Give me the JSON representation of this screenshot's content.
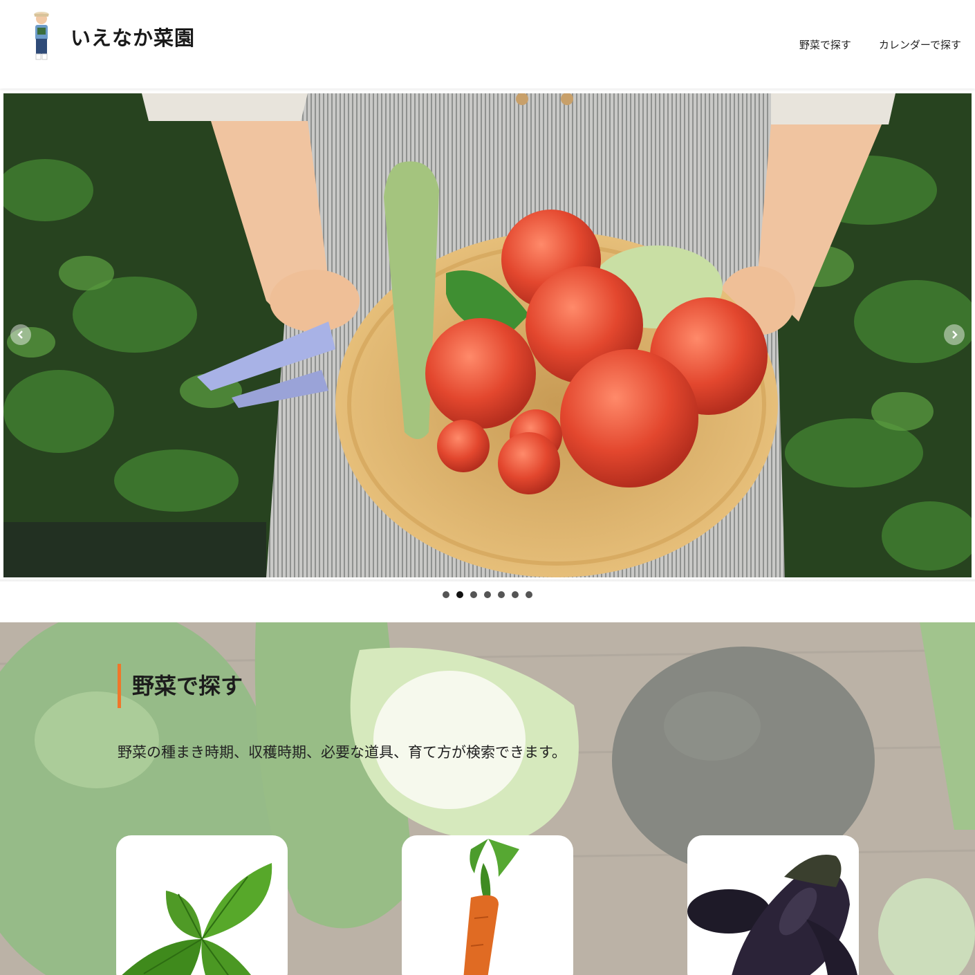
{
  "site": {
    "title": "いえなか菜園"
  },
  "nav": {
    "items": [
      {
        "label": "野菜で探す"
      },
      {
        "label": "カレンダーで探す"
      }
    ]
  },
  "slider": {
    "slide_count": 7,
    "active_index": 1
  },
  "vegetable_search": {
    "heading": "野菜で探す",
    "description": "野菜の種まき時期、収穫時期、必要な道具、育て方が検索できます。",
    "cards": [
      {
        "icon": "basil-icon"
      },
      {
        "icon": "carrot-icon"
      },
      {
        "icon": "eggplant-icon"
      }
    ]
  },
  "colors": {
    "accent": "#f0762a",
    "heading_text": "#1c1c1c"
  }
}
